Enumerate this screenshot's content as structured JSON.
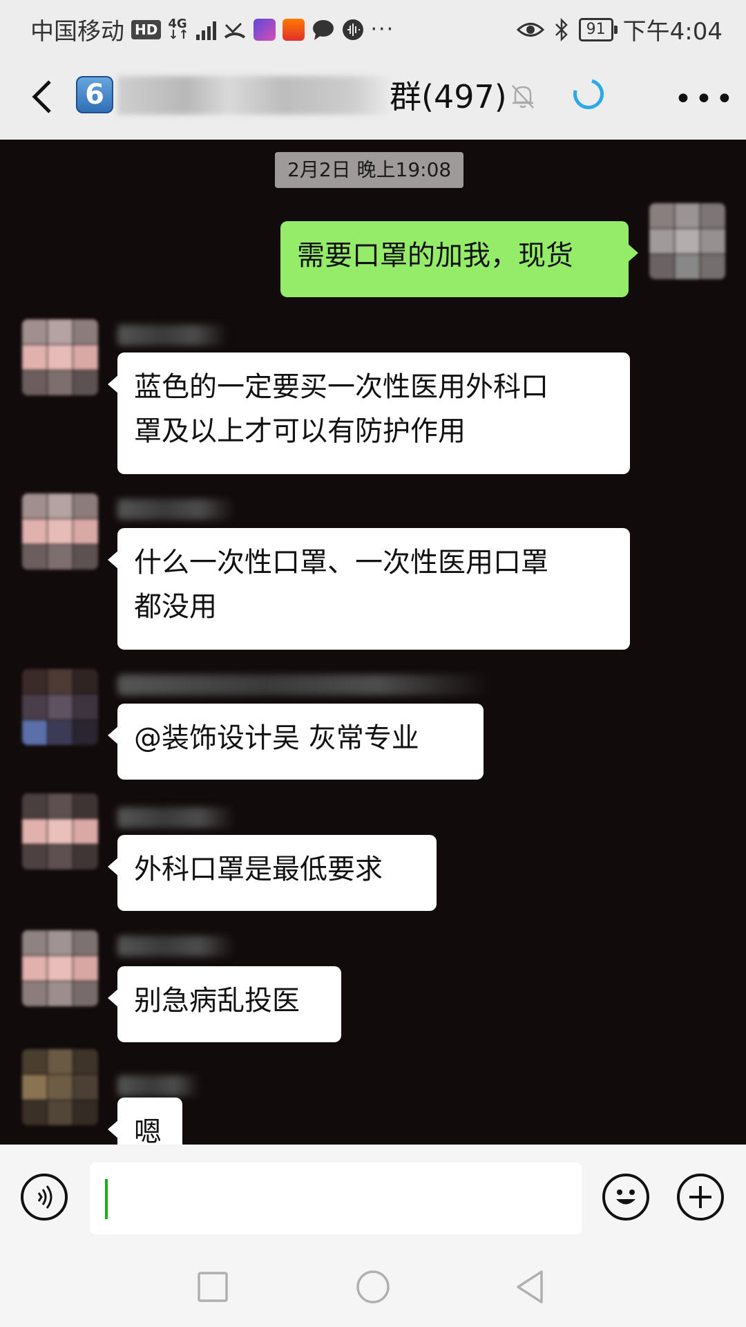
{
  "status_bar": {
    "carrier": "中国移动",
    "hd_badge": "HD",
    "network": "4G",
    "network_sub": "↓↑",
    "overflow": "···",
    "battery": "91",
    "time": "下午4:04"
  },
  "header": {
    "group_number": "6",
    "title_visible": "群(497)"
  },
  "chat": {
    "timestamp": "2月2日 晚上19:08",
    "messages": [
      {
        "side": "right",
        "text_lines": [
          "需要口罩的加我，现货"
        ]
      },
      {
        "side": "left",
        "text_lines": [
          "蓝色的一定要买一次性医用外科口",
          "罩及以上才可以有防护作用"
        ]
      },
      {
        "side": "left",
        "text_lines": [
          "什么一次性口罩、一次性医用口罩",
          "都没用"
        ]
      },
      {
        "side": "left",
        "text_lines": [
          "@装饰设计吴  灰常专业"
        ]
      },
      {
        "side": "left",
        "text_lines": [
          "外科口罩是最低要求"
        ]
      },
      {
        "side": "left",
        "text_lines": [
          "别急病乱投医"
        ]
      },
      {
        "side": "left",
        "text_lines": [
          "嗯"
        ]
      }
    ]
  },
  "input": {
    "value": "",
    "voice_icon": "voice-icon",
    "emoji_icon": "emoji-icon",
    "plus_icon": "plus-icon"
  },
  "nav": {
    "icons": [
      "square-recents-icon",
      "circle-home-icon",
      "triangle-back-icon"
    ]
  },
  "colors": {
    "my_bubble": "#95ec69",
    "other_bubble": "#ffffff",
    "chat_bg": "#120b0b",
    "header_bg": "#ededed",
    "accent_spinner": "#2ba9e8"
  }
}
